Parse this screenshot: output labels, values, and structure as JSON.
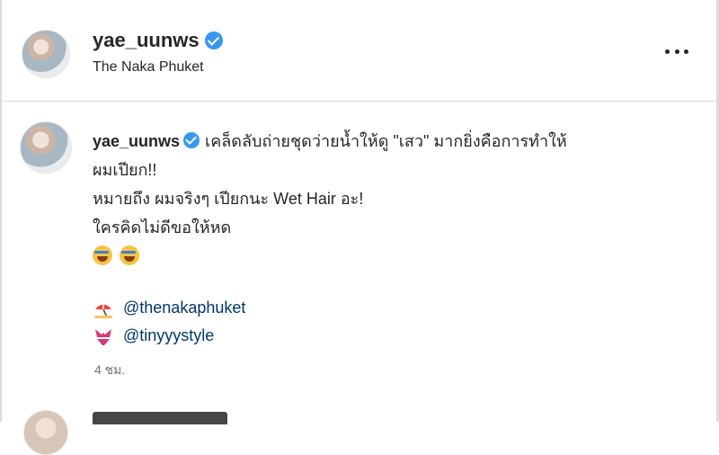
{
  "header": {
    "username": "yae_uunws",
    "location": "The Naka Phuket"
  },
  "post": {
    "username": "yae_uunws",
    "caption_lines": [
      "เคล็ดลับถ่ายชุดว่ายน้ำให้ดู \"เสว\" มากยิ่งคือการทำให้",
      "ผมเปียก!!",
      "หมายถึง ผมจริงๆ เปียกนะ Wet Hair อะ!",
      "ใครคิดไม่ดีขอให้หด"
    ],
    "emojis": [
      "rolling-on-floor-laughing",
      "rolling-on-floor-laughing"
    ],
    "tags": [
      {
        "icon": "beach-umbrella-icon",
        "handle": "@thenakaphuket"
      },
      {
        "icon": "bikini-icon",
        "handle": "@tinyyystyle"
      }
    ],
    "timestamp": "4 ชม."
  },
  "colors": {
    "text": "#262626",
    "link": "#00376b",
    "verified": "#3897f0",
    "muted": "#737373",
    "border": "#dbdbdb"
  }
}
